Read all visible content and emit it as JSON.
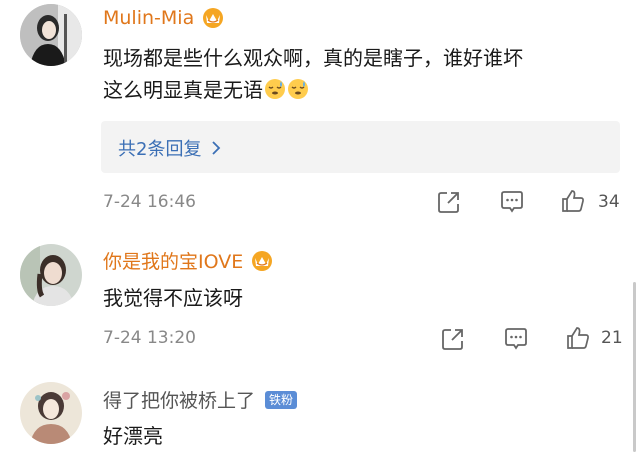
{
  "comments": [
    {
      "username": "Mulin-Mia",
      "text_line1": "现场都是些什么观众啊，真的是瞎子，谁好谁坏",
      "text_line2": "这么明显真是无语",
      "emoji_icon": "sleepy-sweat-face-icon",
      "replies_label": "共2条回复",
      "timestamp": "7-24 16:46",
      "like_count": "34",
      "badge_icon": "crown-vip-icon"
    },
    {
      "username": "你是我的宝IOVE",
      "text": "我觉得不应该呀",
      "timestamp": "7-24 13:20",
      "like_count": "21",
      "badge_icon": "crown-vip-icon"
    },
    {
      "username": "得了把你被桥上了",
      "badge_label": "铁粉",
      "text": "好漂亮"
    }
  ],
  "colors": {
    "username_vip": "#e0771b",
    "link_blue": "#3b6fb5",
    "meta_gray": "#888888",
    "badge_blue": "#5b8dd6"
  }
}
